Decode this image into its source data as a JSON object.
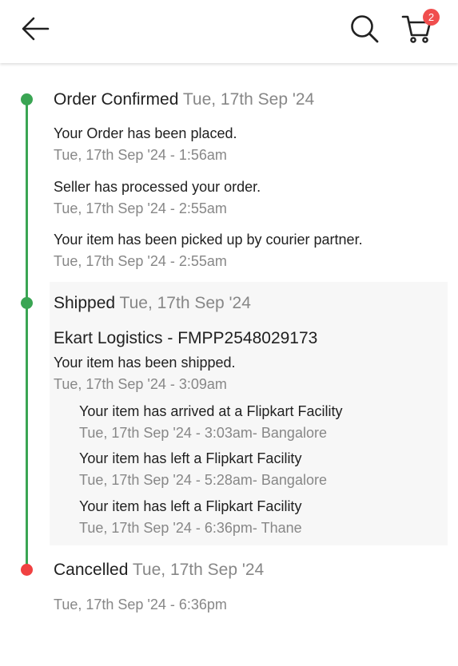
{
  "header": {
    "back_icon": "arrow-left-icon",
    "search_icon": "search-icon",
    "cart_icon": "cart-icon",
    "cart_badge": "2"
  },
  "timeline": {
    "confirmed": {
      "title": "Order Confirmed",
      "date": "Tue, 17th Sep '24",
      "events": [
        {
          "text": "Your Order has been placed.",
          "time": "Tue, 17th Sep '24 - 1:56am"
        },
        {
          "text": "Seller has processed your order.",
          "time": "Tue, 17th Sep '24 - 2:55am"
        },
        {
          "text": "Your item has been picked up by courier partner.",
          "time": "Tue, 17th Sep '24 - 2:55am"
        }
      ]
    },
    "shipped": {
      "title": "Shipped",
      "date": "Tue, 17th Sep '24",
      "courier": "Ekart Logistics - FMPP2548029173",
      "text": "Your item has been shipped.",
      "time": "Tue, 17th Sep '24 - 3:09am",
      "sub_events": [
        {
          "text": "Your item has arrived at a Flipkart Facility",
          "time": "Tue, 17th Sep '24 - 3:03am- Bangalore"
        },
        {
          "text": "Your item has left a Flipkart Facility",
          "time": "Tue, 17th Sep '24 - 5:28am- Bangalore"
        },
        {
          "text": "Your item has left a Flipkart Facility",
          "time": "Tue, 17th Sep '24 - 6:36pm- Thane"
        }
      ]
    },
    "cancelled": {
      "title": "Cancelled",
      "date": "Tue, 17th Sep '24",
      "time": "Tue, 17th Sep '24 - 6:36pm"
    }
  },
  "colors": {
    "progress": "#3aa553",
    "cancelled": "#f04141",
    "muted": "#878787",
    "badge": "#f04e4e"
  }
}
